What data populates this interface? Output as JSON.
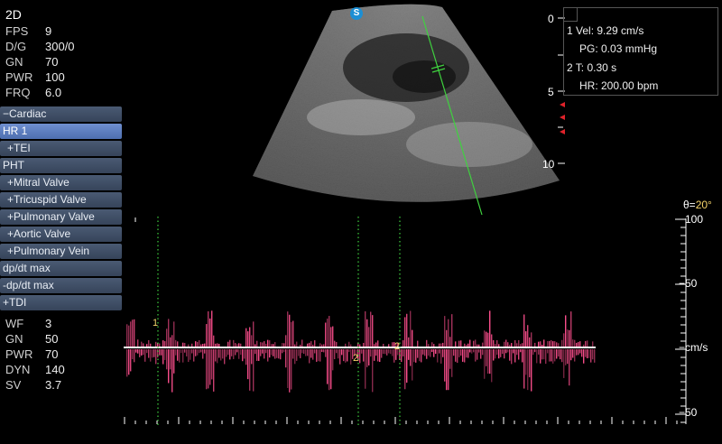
{
  "mode": "2D",
  "params_2d": [
    {
      "key": "FPS",
      "val": "9"
    },
    {
      "key": "D/G",
      "val": "300/0"
    },
    {
      "key": "GN",
      "val": "70"
    },
    {
      "key": "PWR",
      "val": "100"
    },
    {
      "key": "FRQ",
      "val": "6.0"
    }
  ],
  "menu": [
    {
      "label": "−Cardiac",
      "active": false,
      "indent": false
    },
    {
      "label": "HR    1",
      "active": true,
      "indent": false
    },
    {
      "label": "+TEI",
      "active": false,
      "indent": true
    },
    {
      "label": "PHT",
      "active": false,
      "indent": false
    },
    {
      "label": "+Mitral Valve",
      "active": false,
      "indent": true
    },
    {
      "label": "+Tricuspid Valve",
      "active": false,
      "indent": true
    },
    {
      "label": "+Pulmonary Valve",
      "active": false,
      "indent": true
    },
    {
      "label": "+Aortic Valve",
      "active": false,
      "indent": true
    },
    {
      "label": "+Pulmonary Vein",
      "active": false,
      "indent": true
    },
    {
      "label": "dp/dt max",
      "active": false,
      "indent": false
    },
    {
      "label": "-dp/dt max",
      "active": false,
      "indent": false
    },
    {
      "label": "+TDI",
      "active": false,
      "indent": false
    }
  ],
  "params_doppler": [
    {
      "key": "WF",
      "val": "3"
    },
    {
      "key": "GN",
      "val": "50"
    },
    {
      "key": "PWR",
      "val": "70"
    },
    {
      "key": "DYN",
      "val": "140"
    },
    {
      "key": "SV",
      "val": "3.7"
    }
  ],
  "measurements": {
    "l1": "1  Vel: 9.29   cm/s",
    "l2": "PG: 0.03   mmHg",
    "l3": "2  T: 0.30   s",
    "l4": "HR: 200.00 bpm"
  },
  "depth_labels": [
    "0",
    "5",
    "10"
  ],
  "theta": {
    "prefix": "θ=",
    "value": "20°"
  },
  "velocity_labels": {
    "top": "−100",
    "mid_upper": "−50",
    "baseline": "−cm/s",
    "bottom": "−50"
  },
  "marker_labels": [
    "1",
    "2",
    "2"
  ],
  "logo_letter": "S",
  "colors": {
    "doppler": "#ff4f8e",
    "caliper": "#3fd23f",
    "baseline": "#ffffff",
    "accent": "#f3d36a"
  }
}
